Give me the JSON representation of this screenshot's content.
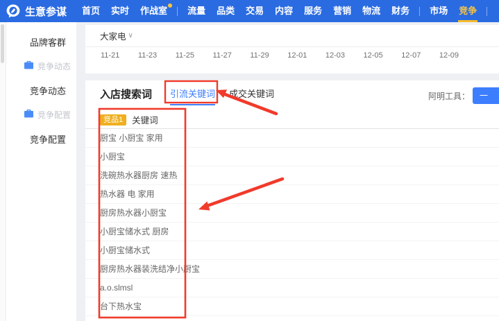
{
  "nav": {
    "brand": "生意参谋",
    "home": "首页",
    "realtime": "实时",
    "war_room": "作战室",
    "traffic": "流量",
    "category": "品类",
    "trade": "交易",
    "content": "内容",
    "service": "服务",
    "marketing": "营销",
    "logistics": "物流",
    "finance": "财务",
    "market": "市场",
    "compete": "竞争"
  },
  "sidebar": {
    "brand_group_title": "品牌客群",
    "compete_dynamics_item": "竞争动态",
    "compete_dynamics_title": "竞争动态",
    "compete_config_item": "竞争配置",
    "compete_config_title": "竞争配置"
  },
  "trend_card": {
    "category_filter": "大家电",
    "dates": [
      "11-21",
      "11-23",
      "11-25",
      "11-27",
      "11-29",
      "12-01",
      "12-03",
      "12-05",
      "12-07",
      "12-09"
    ]
  },
  "search_card": {
    "title": "入店搜索词",
    "tab_traffic_keywords": "引流关键词",
    "tab_deal_keywords": "成交关键词",
    "tool_label": "阿明工具：",
    "tool_button_partial": "一"
  },
  "keywords_table": {
    "competitor_badge": "竞品1",
    "header": "关键词",
    "rows": [
      "厨宝 小厨宝 家用",
      "小厨宝",
      "洗碗热水器厨房 速热",
      "热水器 电 家用",
      "厨房热水器小厨宝",
      "小厨宝储水式 厨房",
      "小厨宝储水式",
      "厨房热水器装洗结净小厨宝",
      "a.o.slmsl",
      "台下热水宝"
    ]
  },
  "colors": {
    "nav_blue": "#2A6BE2",
    "active_gold": "#F6C343",
    "link_blue": "#3D7EFF",
    "annotation_red": "#F13A2B",
    "badge_gold": "#EFAF1F"
  }
}
